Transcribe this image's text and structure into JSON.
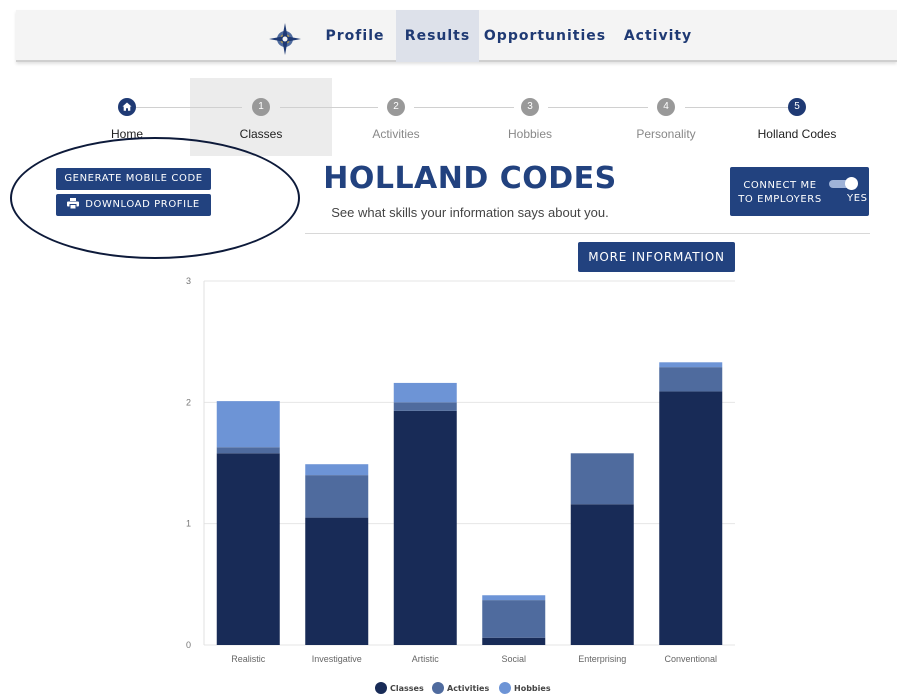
{
  "nav": {
    "links": [
      "Profile",
      "Results",
      "Opportunities",
      "Activity"
    ],
    "logo_icon": "compass-star-icon"
  },
  "stepper": {
    "steps": [
      {
        "number": "",
        "icon": "home-icon",
        "label": "Home"
      },
      {
        "number": "1",
        "label": "Classes"
      },
      {
        "number": "2",
        "label": "Activities"
      },
      {
        "number": "3",
        "label": "Hobbies"
      },
      {
        "number": "4",
        "label": "Personality"
      },
      {
        "number": "5",
        "label": "Holland Codes"
      }
    ]
  },
  "actions": {
    "generate_mobile_code": "GENERATE MOBILE CODE",
    "download_profile": "DOWNLOAD PROFILE",
    "connect_line1": "CONNECT ME",
    "connect_line2": "TO EMPLOYERS",
    "connect_toggle_state": "YES",
    "more_information": "MORE INFORMATION"
  },
  "header": {
    "title": "HOLLAND CODES",
    "subtitle": "See what skills your information says about you."
  },
  "colors": {
    "accent": "#22427f",
    "classes": "#182b57",
    "activities": "#4f6b9e",
    "hobbies": "#6d94d6"
  },
  "chart_data": {
    "type": "bar",
    "stacked": true,
    "categories": [
      "Realistic",
      "Investigative",
      "Artistic",
      "Social",
      "Enterprising",
      "Conventional"
    ],
    "series": [
      {
        "name": "Classes",
        "values": [
          1.58,
          1.05,
          1.93,
          0.06,
          1.16,
          2.09
        ]
      },
      {
        "name": "Activities",
        "values": [
          0.05,
          0.35,
          0.07,
          0.31,
          0.42,
          0.2
        ]
      },
      {
        "name": "Hobbies",
        "values": [
          0.38,
          0.09,
          0.16,
          0.04,
          0.0,
          0.04
        ]
      }
    ],
    "ylim": [
      0,
      3
    ],
    "yticks": [
      "0",
      "1",
      "2",
      "3"
    ],
    "grid": true,
    "legend": "bottom"
  }
}
